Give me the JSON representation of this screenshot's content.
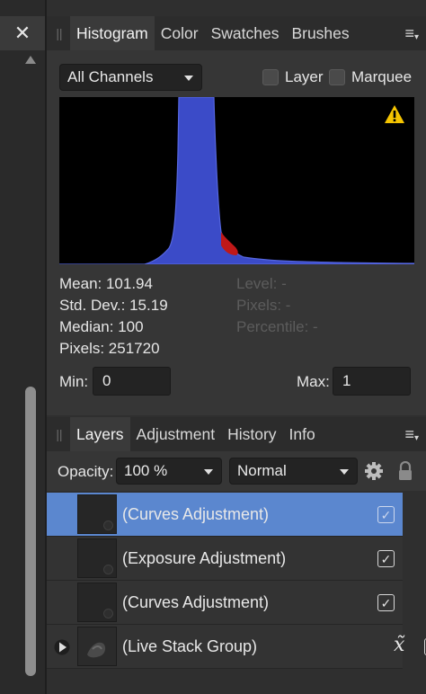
{
  "left_strip": {
    "close_glyph": "✕",
    "scroll_up_icon": "triangle-up"
  },
  "histogram_panel": {
    "tabs": [
      "Histogram",
      "Color",
      "Swatches",
      "Brushes"
    ],
    "active_tab": "Histogram",
    "channel_select": "All Channels",
    "layer_checkbox_label": "Layer",
    "marquee_checkbox_label": "Marquee",
    "warning_icon": "warning-triangle",
    "stats": {
      "mean": "Mean: 101.94",
      "std_dev": "Std. Dev.: 15.19",
      "median": "Median: 100",
      "pixels": "Pixels: 251720",
      "level": "Level: -",
      "pixels_hover": "Pixels: -",
      "percentile": "Percentile: -"
    },
    "min_label": "Min:",
    "min_value": "0",
    "max_label": "Max:",
    "max_value": "1",
    "colors": {
      "blue_channel": "#3b4bc8",
      "red_channel": "#c01818",
      "warning": "#f5c400"
    }
  },
  "layers_panel": {
    "tabs": [
      "Layers",
      "Adjustment",
      "History",
      "Info"
    ],
    "active_tab": "Layers",
    "opacity_label": "Opacity:",
    "opacity_value": "100 %",
    "blend_mode": "Normal",
    "layers": [
      {
        "name": "(Curves Adjustment)",
        "selected": true,
        "visible": true
      },
      {
        "name": "(Exposure Adjustment)",
        "selected": false,
        "visible": true
      },
      {
        "name": "(Curves Adjustment)",
        "selected": false,
        "visible": true
      },
      {
        "name": "(Live Stack Group)",
        "selected": false,
        "visible": true,
        "has_fx": true,
        "fx_glyph": "x̃"
      }
    ],
    "check_glyph": "✓",
    "selection_color": "#5b87cf"
  },
  "menu_glyph": "≡"
}
